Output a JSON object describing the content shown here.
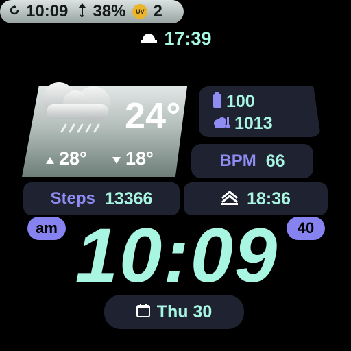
{
  "header": {
    "time": "17:39",
    "icon": "sunrise-icon"
  },
  "status": {
    "time": "10:09",
    "moisture": "38%",
    "uv_label": "UV",
    "uv_value": "2"
  },
  "weather": {
    "temperature": "24°",
    "high": "28°",
    "low": "18°",
    "icon": "cloud-rain-icon"
  },
  "battery": {
    "value": "100"
  },
  "pressure": {
    "value": "1013"
  },
  "heart": {
    "label": "BPM",
    "value": "66"
  },
  "steps": {
    "label": "Steps",
    "value": "13366"
  },
  "sunset": {
    "time": "18:36"
  },
  "clock": {
    "ampm": "am",
    "time": "10:09",
    "seconds": "40"
  },
  "date": {
    "text": "Thu 30"
  },
  "colors": {
    "accent": "#a8f5e2",
    "lavender": "#8f8cf2",
    "card": "#1f2230",
    "badge": "#8683f0"
  }
}
